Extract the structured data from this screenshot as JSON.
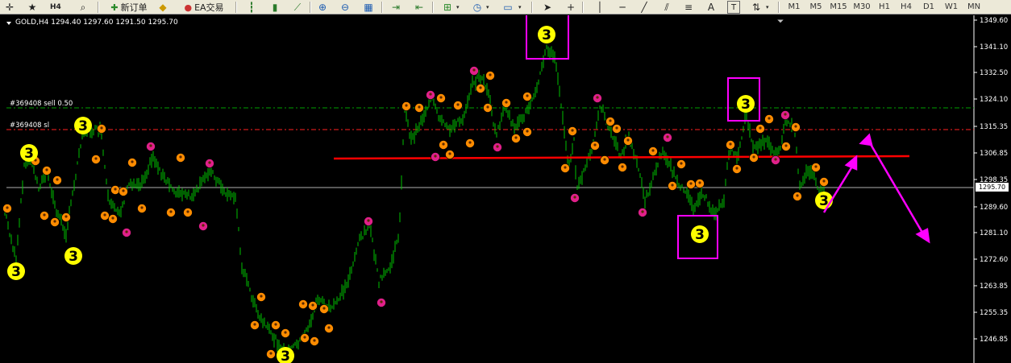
{
  "toolbar": {
    "buttons": [
      {
        "name": "crosshair-icon",
        "glyph": "✛"
      },
      {
        "name": "favorites-icon",
        "glyph": "★"
      },
      {
        "name": "h4-icon",
        "glyph": "H4"
      },
      {
        "name": "zoom-window-icon",
        "glyph": "⌕"
      }
    ],
    "new_order_label": "新订单",
    "ea_label": "EA交易",
    "timeframes": [
      "M1",
      "M5",
      "M15",
      "M30",
      "H1",
      "H4",
      "D1",
      "W1",
      "MN"
    ],
    "tool_glyphs": [
      "A",
      "T"
    ]
  },
  "chart": {
    "symbol_header": "GOLD,H4  1294.40 1297.60 1291.50 1295.70",
    "order_sell_label": "#369408 sell 0.50",
    "order_sl_label": "#369408 sl",
    "current_price": "1295.70",
    "price_ticks": [
      "1349.60",
      "1341.10",
      "1332.50",
      "1324.10",
      "1315.35",
      "1306.85",
      "1298.35",
      "1289.60",
      "1281.10",
      "1272.60",
      "1263.85",
      "1255.35",
      "1246.85"
    ],
    "marker_label": "3",
    "colors": {
      "background": "#000000",
      "candles": "#00c000",
      "sell_line": "#00a000",
      "sl_line": "#ff2020",
      "support_line": "#ff0000",
      "markers": "#ff00ff",
      "label_circle": "#ffff00",
      "axis_text": "#ffffff"
    }
  }
}
